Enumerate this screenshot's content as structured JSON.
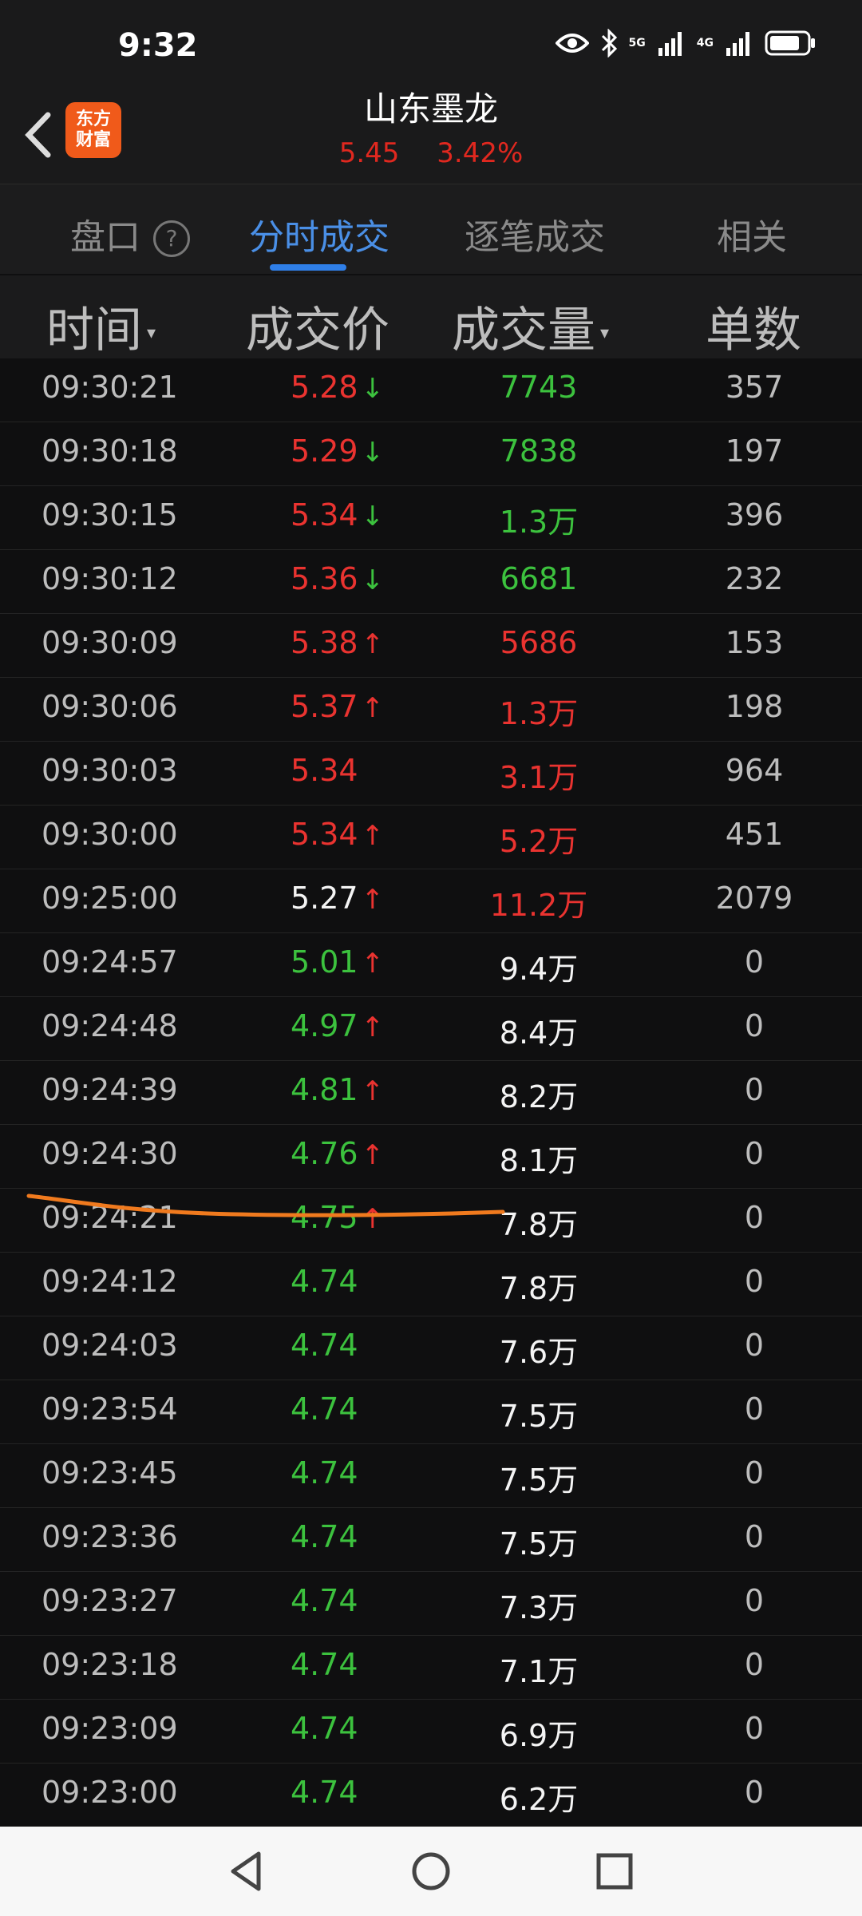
{
  "status": {
    "time": "9:32",
    "net1": "5G",
    "net2": "4G"
  },
  "header": {
    "logo_line1": "东方",
    "logo_line2": "财富",
    "title": "山东墨龙",
    "price": "5.45",
    "change": "3.42%"
  },
  "tabs": [
    {
      "label": "盘口"
    },
    {
      "label": "分时成交"
    },
    {
      "label": "逐笔成交"
    },
    {
      "label": "相关"
    }
  ],
  "columns": {
    "time": "时间",
    "price": "成交价",
    "volume": "成交量",
    "count": "单数"
  },
  "rows": [
    {
      "time": "09:30:21",
      "price": "5.28",
      "arrow": "↓",
      "price_color": "red",
      "arrow_color": "green",
      "volume": "7743",
      "vol_color": "green",
      "count": "357"
    },
    {
      "time": "09:30:18",
      "price": "5.29",
      "arrow": "↓",
      "price_color": "red",
      "arrow_color": "green",
      "volume": "7838",
      "vol_color": "green",
      "count": "197"
    },
    {
      "time": "09:30:15",
      "price": "5.34",
      "arrow": "↓",
      "price_color": "red",
      "arrow_color": "green",
      "volume": "1.3万",
      "vol_color": "green",
      "count": "396"
    },
    {
      "time": "09:30:12",
      "price": "5.36",
      "arrow": "↓",
      "price_color": "red",
      "arrow_color": "green",
      "volume": "6681",
      "vol_color": "green",
      "count": "232"
    },
    {
      "time": "09:30:09",
      "price": "5.38",
      "arrow": "↑",
      "price_color": "red",
      "arrow_color": "red",
      "volume": "5686",
      "vol_color": "red",
      "count": "153"
    },
    {
      "time": "09:30:06",
      "price": "5.37",
      "arrow": "↑",
      "price_color": "red",
      "arrow_color": "red",
      "volume": "1.3万",
      "vol_color": "red",
      "count": "198"
    },
    {
      "time": "09:30:03",
      "price": "5.34",
      "arrow": "",
      "price_color": "red",
      "arrow_color": "red",
      "volume": "3.1万",
      "vol_color": "red",
      "count": "964"
    },
    {
      "time": "09:30:00",
      "price": "5.34",
      "arrow": "↑",
      "price_color": "red",
      "arrow_color": "red",
      "volume": "5.2万",
      "vol_color": "red",
      "count": "451"
    },
    {
      "time": "09:25:00",
      "price": "5.27",
      "arrow": "↑",
      "price_color": "white",
      "arrow_color": "red",
      "volume": "11.2万",
      "vol_color": "red",
      "count": "2079"
    },
    {
      "time": "09:24:57",
      "price": "5.01",
      "arrow": "↑",
      "price_color": "green",
      "arrow_color": "red",
      "volume": "9.4万",
      "vol_color": "white",
      "count": "0"
    },
    {
      "time": "09:24:48",
      "price": "4.97",
      "arrow": "↑",
      "price_color": "green",
      "arrow_color": "red",
      "volume": "8.4万",
      "vol_color": "white",
      "count": "0"
    },
    {
      "time": "09:24:39",
      "price": "4.81",
      "arrow": "↑",
      "price_color": "green",
      "arrow_color": "red",
      "volume": "8.2万",
      "vol_color": "white",
      "count": "0"
    },
    {
      "time": "09:24:30",
      "price": "4.76",
      "arrow": "↑",
      "price_color": "green",
      "arrow_color": "red",
      "volume": "8.1万",
      "vol_color": "white",
      "count": "0"
    },
    {
      "time": "09:24:21",
      "price": "4.75",
      "arrow": "↑",
      "price_color": "green",
      "arrow_color": "red",
      "volume": "7.8万",
      "vol_color": "white",
      "count": "0"
    },
    {
      "time": "09:24:12",
      "price": "4.74",
      "arrow": "",
      "price_color": "green",
      "arrow_color": "red",
      "volume": "7.8万",
      "vol_color": "white",
      "count": "0"
    },
    {
      "time": "09:24:03",
      "price": "4.74",
      "arrow": "",
      "price_color": "green",
      "arrow_color": "red",
      "volume": "7.6万",
      "vol_color": "white",
      "count": "0"
    },
    {
      "time": "09:23:54",
      "price": "4.74",
      "arrow": "",
      "price_color": "green",
      "arrow_color": "red",
      "volume": "7.5万",
      "vol_color": "white",
      "count": "0"
    },
    {
      "time": "09:23:45",
      "price": "4.74",
      "arrow": "",
      "price_color": "green",
      "arrow_color": "red",
      "volume": "7.5万",
      "vol_color": "white",
      "count": "0"
    },
    {
      "time": "09:23:36",
      "price": "4.74",
      "arrow": "",
      "price_color": "green",
      "arrow_color": "red",
      "volume": "7.5万",
      "vol_color": "white",
      "count": "0"
    },
    {
      "time": "09:23:27",
      "price": "4.74",
      "arrow": "",
      "price_color": "green",
      "arrow_color": "red",
      "volume": "7.3万",
      "vol_color": "white",
      "count": "0"
    },
    {
      "time": "09:23:18",
      "price": "4.74",
      "arrow": "",
      "price_color": "green",
      "arrow_color": "red",
      "volume": "7.1万",
      "vol_color": "white",
      "count": "0"
    },
    {
      "time": "09:23:09",
      "price": "4.74",
      "arrow": "",
      "price_color": "green",
      "arrow_color": "red",
      "volume": "6.9万",
      "vol_color": "white",
      "count": "0"
    },
    {
      "time": "09:23:00",
      "price": "4.74",
      "arrow": "",
      "price_color": "green",
      "arrow_color": "red",
      "volume": "6.2万",
      "vol_color": "white",
      "count": "0"
    }
  ],
  "colors": {
    "up": "#ea3330",
    "down": "#3cc23e",
    "neutral": "#f4f4f4",
    "accent": "#2f7fe8",
    "annotation": "#f07a1e"
  }
}
